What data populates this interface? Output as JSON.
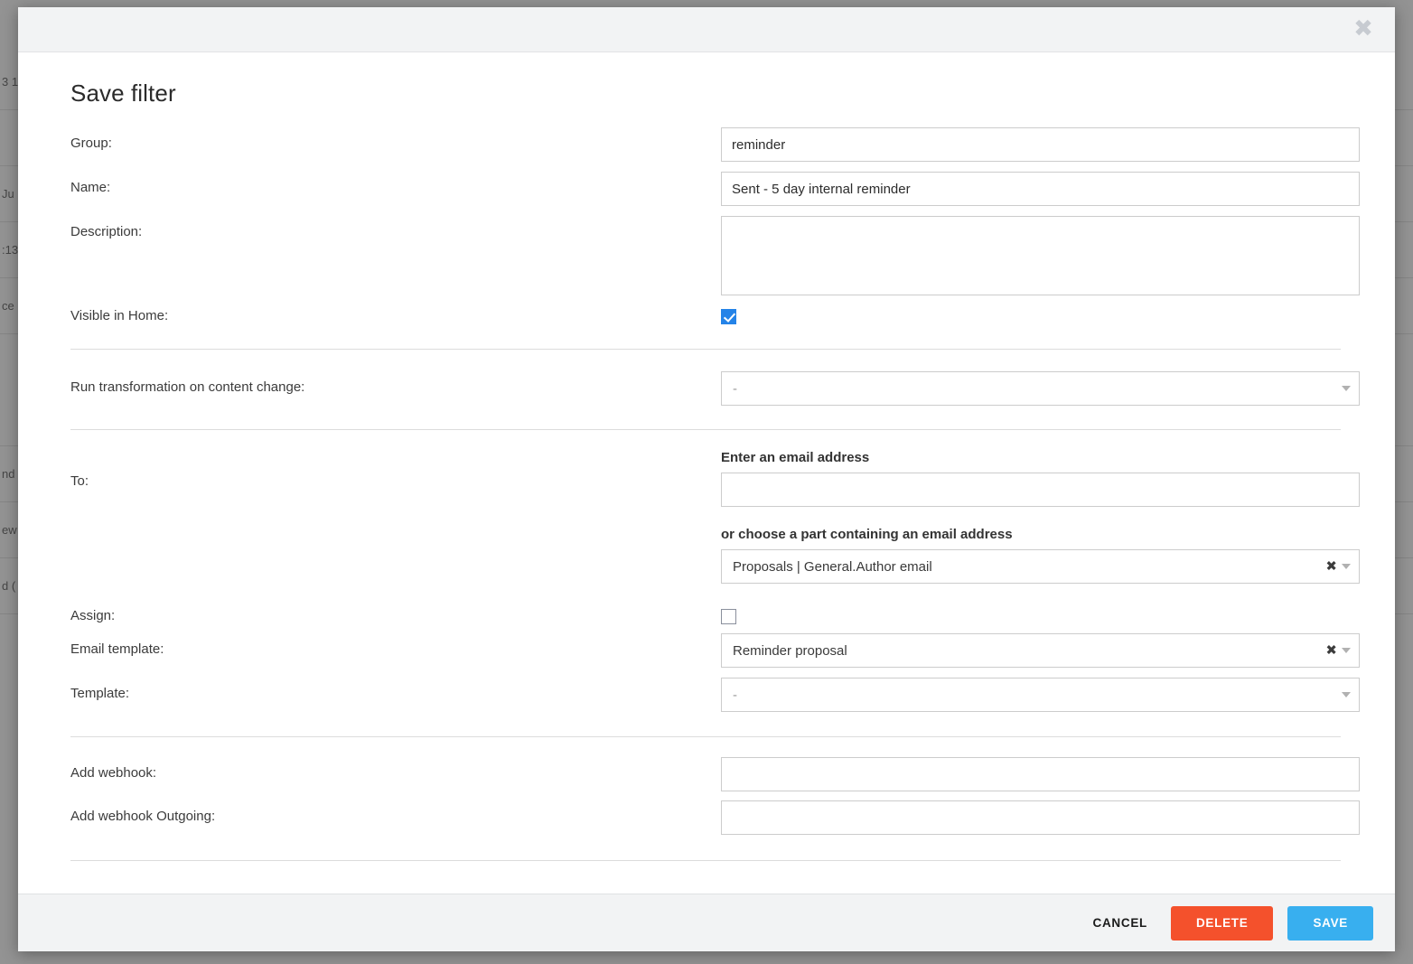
{
  "background": {
    "rows": [
      "3 1",
      "",
      "Ju",
      ":13",
      "ce",
      "",
      "nd",
      "ew",
      "d ("
    ]
  },
  "modal": {
    "title": "Save filter",
    "close_icon": "close-icon",
    "fields": {
      "group": {
        "label": "Group:",
        "value": "reminder",
        "placeholder": ""
      },
      "name": {
        "label": "Name:",
        "value": "Sent - 5 day internal reminder",
        "placeholder": ""
      },
      "description": {
        "label": "Description:",
        "value": "",
        "placeholder": ""
      },
      "visible_in_home": {
        "label": "Visible in Home:",
        "checked": true
      },
      "run_transformation": {
        "label": "Run transformation on content change:",
        "value": "-"
      },
      "to": {
        "label": "To:",
        "email_input_label": "Enter an email address",
        "email_value": "",
        "email_placeholder": "",
        "part_label": "or choose a part containing an email address",
        "part_value": "Proposals | General.Author email",
        "clear_glyph": "✖"
      },
      "assign": {
        "label": "Assign:",
        "checked": false
      },
      "email_template": {
        "label": "Email template:",
        "value": "Reminder proposal",
        "clear_glyph": "✖"
      },
      "template": {
        "label": "Template:",
        "value": "-"
      },
      "add_webhook": {
        "label": "Add webhook:",
        "value": "",
        "placeholder": ""
      },
      "add_webhook_outgoing": {
        "label": "Add webhook Outgoing:",
        "value": "",
        "placeholder": ""
      }
    },
    "footer": {
      "cancel_label": "CANCEL",
      "delete_label": "DELETE",
      "save_label": "SAVE"
    }
  },
  "colors": {
    "delete": "#f4512c",
    "save": "#38afef",
    "checkbox_checked": "#2483e8"
  }
}
